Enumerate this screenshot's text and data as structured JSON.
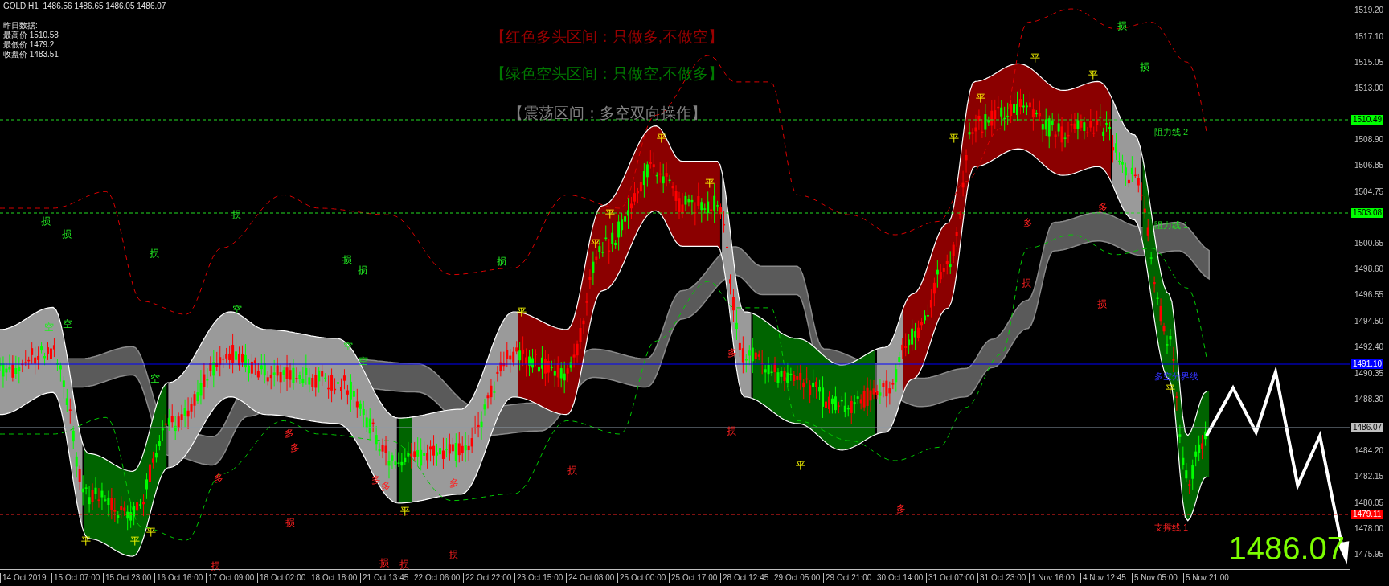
{
  "header": {
    "symbol": "GOLD,H1",
    "ohlc": "1486.56 1486.65 1486.05 1486.07"
  },
  "yesterday": {
    "title": "昨日数据:",
    "rows": [
      "最高价 1510.58",
      "最低价 1479.2",
      "收盘价 1483.51"
    ]
  },
  "legend": [
    {
      "text": "【红色多头区间：只做多,不做空】",
      "kind": "bull"
    },
    {
      "text": "【绿色空头区间：只做空,不做多】",
      "kind": "bear"
    },
    {
      "text": "【震荡区间：多空双向操作】",
      "kind": "range"
    }
  ],
  "levels": [
    {
      "label": "阻力线 2",
      "tag": "1510.49",
      "kind": "resistance"
    },
    {
      "label": "阻力线 1",
      "tag": "1503.08",
      "kind": "resistance"
    },
    {
      "label": "多空分界线",
      "tag": "1491.10",
      "kind": "pivot"
    },
    {
      "tag": "1486.07",
      "kind": "current"
    },
    {
      "label": "支撑线 1",
      "tag": "1479.11",
      "kind": "support"
    }
  ],
  "markers": [
    {
      "text": "平",
      "kind": "exit"
    },
    {
      "text": "平",
      "kind": "exit"
    },
    {
      "text": "平",
      "kind": "exit"
    },
    {
      "text": "平",
      "kind": "exit"
    },
    {
      "text": "平",
      "kind": "exit"
    },
    {
      "text": "平",
      "kind": "exit"
    },
    {
      "text": "平",
      "kind": "exit"
    },
    {
      "text": "平",
      "kind": "exit"
    },
    {
      "text": "平",
      "kind": "exit"
    },
    {
      "text": "平",
      "kind": "exit"
    },
    {
      "text": "平",
      "kind": "exit"
    },
    {
      "text": "平",
      "kind": "exit"
    },
    {
      "text": "平",
      "kind": "exit"
    },
    {
      "text": "平",
      "kind": "exit"
    },
    {
      "text": "平",
      "kind": "exit"
    },
    {
      "text": "多",
      "kind": "long"
    },
    {
      "text": "多",
      "kind": "long"
    },
    {
      "text": "多",
      "kind": "long"
    },
    {
      "text": "多",
      "kind": "long"
    },
    {
      "text": "多",
      "kind": "long"
    },
    {
      "text": "多",
      "kind": "long"
    },
    {
      "text": "多",
      "kind": "long"
    },
    {
      "text": "多",
      "kind": "long"
    },
    {
      "text": "多",
      "kind": "long"
    },
    {
      "text": "多",
      "kind": "long"
    },
    {
      "text": "空",
      "kind": "short"
    },
    {
      "text": "空",
      "kind": "short"
    },
    {
      "text": "空",
      "kind": "short"
    },
    {
      "text": "空",
      "kind": "short"
    },
    {
      "text": "空",
      "kind": "short"
    },
    {
      "text": "空",
      "kind": "short"
    },
    {
      "text": "损",
      "kind": "stop_short"
    },
    {
      "text": "损",
      "kind": "stop_short"
    },
    {
      "text": "损",
      "kind": "stop_short"
    },
    {
      "text": "损",
      "kind": "stop_short"
    },
    {
      "text": "损",
      "kind": "stop_short"
    },
    {
      "text": "损",
      "kind": "stop_short"
    },
    {
      "text": "损",
      "kind": "stop_short"
    },
    {
      "text": "损",
      "kind": "stop_short"
    },
    {
      "text": "损",
      "kind": "stop_short"
    },
    {
      "text": "损",
      "kind": "stop_long"
    },
    {
      "text": "损",
      "kind": "stop_long"
    },
    {
      "text": "损",
      "kind": "stop_long"
    },
    {
      "text": "损",
      "kind": "stop_long"
    },
    {
      "text": "损",
      "kind": "stop_long"
    },
    {
      "text": "损",
      "kind": "stop_long"
    },
    {
      "text": "损",
      "kind": "stop_long"
    },
    {
      "text": "损",
      "kind": "stop_long"
    },
    {
      "text": "损",
      "kind": "stop_long"
    }
  ],
  "big_price": "1486.07",
  "price_axis": [
    "1519.20",
    "1517.10",
    "1515.05",
    "1513.00",
    "1508.90",
    "1506.85",
    "1504.75",
    "1500.65",
    "1498.60",
    "1496.55",
    "1494.50",
    "1492.40",
    "1490.35",
    "1488.30",
    "1484.20",
    "1482.15",
    "1480.05",
    "1478.00",
    "1475.95"
  ],
  "time_axis": [
    "14 Oct 2019",
    "15 Oct 07:00",
    "15 Oct 23:00",
    "16 Oct 16:00",
    "17 Oct 09:00",
    "18 Oct 02:00",
    "18 Oct 18:00",
    "21 Oct 13:45",
    "22 Oct 06:00",
    "22 Oct 22:00",
    "23 Oct 15:00",
    "24 Oct 08:00",
    "25 Oct 00:00",
    "25 Oct 17:00",
    "28 Oct 12:45",
    "29 Oct 05:00",
    "29 Oct 21:00",
    "30 Oct 14:00",
    "31 Oct 07:00",
    "31 Oct 23:00",
    "1 Nov 16:00",
    "4 Nov 12:45",
    "5 Nov 05:00",
    "5 Nov 21:00"
  ]
}
